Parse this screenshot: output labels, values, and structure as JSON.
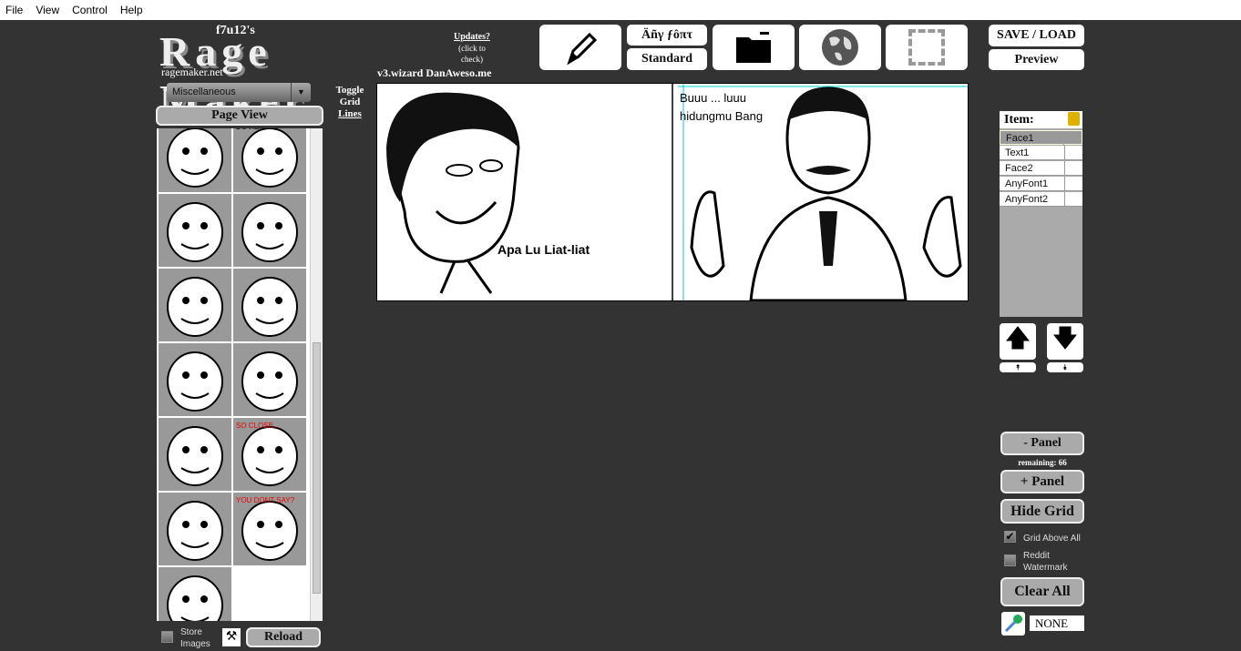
{
  "menu": [
    "File",
    "View",
    "Control",
    "Help"
  ],
  "logo": {
    "author": "f7u12's",
    "title": "Rage Maker",
    "site": "ragemaker.net"
  },
  "updates": {
    "title": "Updates?",
    "sub": "(click to check)"
  },
  "version": "v3.wizard  DanAweso.me",
  "toolbar": {
    "font_any": "Äñγ ƒôπτ",
    "font_standard": "Standard",
    "save_load": "SAVE / LOAD",
    "preview": "Preview",
    "icons": [
      "pencil-icon",
      "font-icon",
      "folder-icon",
      "globe-icon",
      "selection-icon"
    ]
  },
  "category": {
    "selected": "Miscellaneous"
  },
  "page_view": "Page View",
  "toggle_grid": [
    "Toggle",
    "Grid",
    "Lines"
  ],
  "palette": {
    "cells": [
      "face",
      "do-here",
      "face",
      "face",
      "face",
      "face",
      "face",
      "face",
      "face",
      "so-close",
      "face",
      "you-dont-say",
      "face"
    ],
    "captions": {
      "do_here": "DO HERE",
      "so_close": "SO CLOSE...",
      "you_dont_say": "YOU DONT SAY?"
    }
  },
  "store_images": "Store Images",
  "reload": "Reload",
  "canvas": {
    "panel1_text": "Apa Lu Liat-liat",
    "panel2_text_line1": "Buuu ... luuu",
    "panel2_text_line2": "hidungmu Bang"
  },
  "items": {
    "header": "Item:",
    "list": [
      "Face1",
      "Text1",
      "Face2",
      "AnyFont1",
      "AnyFont2"
    ],
    "selected": "Face1"
  },
  "panel": {
    "minus": "- Panel",
    "remaining": "remaining: 66",
    "plus": "+ Panel",
    "hide_grid": "Hide Grid"
  },
  "options": {
    "grid_above_all": "Grid Above All",
    "grid_above_all_checked": true,
    "reddit_watermark": "Reddit Watermark",
    "reddit_watermark_checked": false
  },
  "clear_all": "Clear All",
  "color": {
    "value": "NONE"
  }
}
